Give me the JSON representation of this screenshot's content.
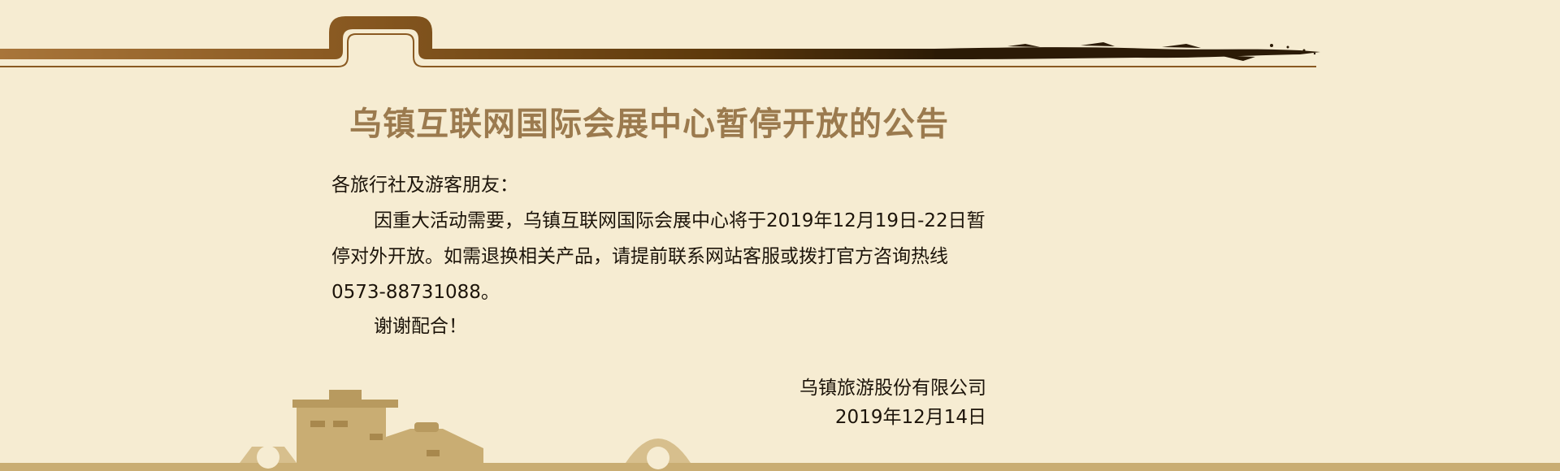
{
  "notice": {
    "title": "乌镇互联网国际会展中心暂停开放的公告",
    "greeting": "各旅行社及游客朋友：",
    "body": "因重大活动需要，乌镇互联网国际会展中心将于2019年12月19日-22日暂停对外开放。如需退换相关产品，请提前联系网站客服或拨打官方咨询热线0573-88731088。",
    "thanks": "谢谢配合！",
    "signature_org": "乌镇旅游股份有限公司",
    "signature_date": "2019年12月14日"
  },
  "colors": {
    "background": "#f6ecd2",
    "title": "#9b7a4e",
    "banner_brown": "#7a4a12",
    "banner_light": "#a8753a",
    "footer_tan": "#c9ad73"
  },
  "icons": {
    "top": "ornamental-brush-banner",
    "bottom": "watertown-house-silhouette"
  }
}
